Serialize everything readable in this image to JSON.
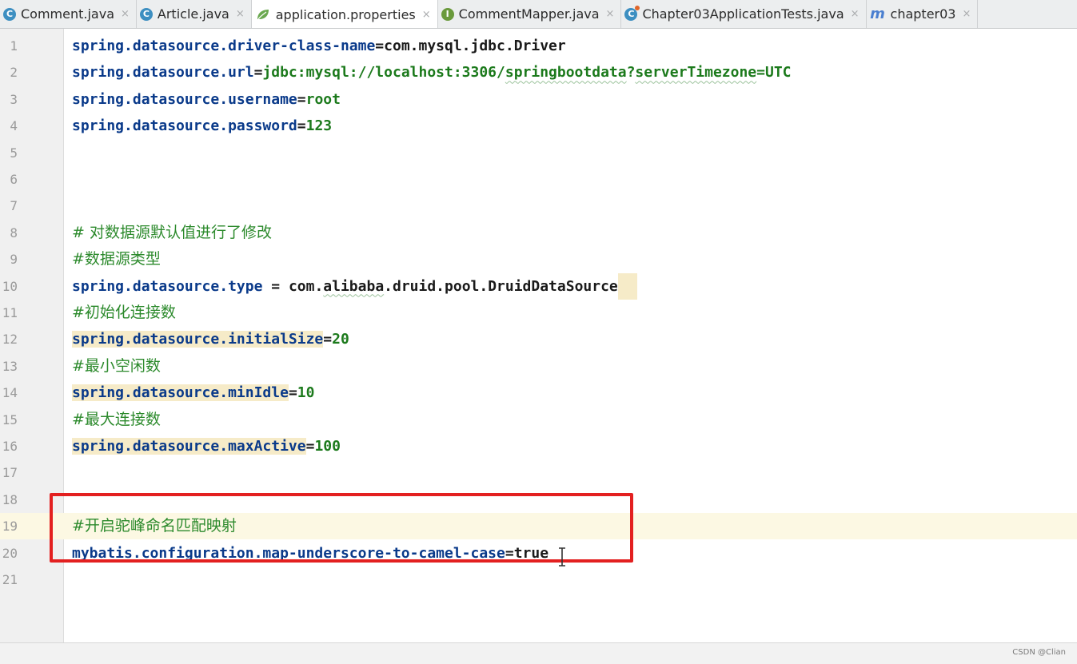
{
  "tabs": [
    {
      "label": "Comment.java",
      "icon": "class-icon",
      "glyph": "C",
      "active": false
    },
    {
      "label": "Article.java",
      "icon": "class-icon",
      "glyph": "C",
      "active": false
    },
    {
      "label": "application.properties",
      "icon": "spring-leaf-icon",
      "glyph": "",
      "active": true
    },
    {
      "label": "CommentMapper.java",
      "icon": "interface-icon",
      "glyph": "I",
      "active": false
    },
    {
      "label": "Chapter03ApplicationTests.java",
      "icon": "test-class-icon",
      "glyph": "C",
      "active": false
    },
    {
      "label": "chapter03",
      "icon": "maven-icon",
      "glyph": "m",
      "active": false
    }
  ],
  "close_glyph": "×",
  "editor": {
    "current_line": 19,
    "lines": [
      {
        "n": "1",
        "parts": [
          {
            "t": "spring.datasource.driver-class-name",
            "c": "key"
          },
          {
            "t": "=",
            "c": "sep"
          },
          {
            "t": "com.mysql.jdbc.Driver",
            "c": "val-plain"
          }
        ]
      },
      {
        "n": "2",
        "parts": [
          {
            "t": "spring.datasource.url",
            "c": "key"
          },
          {
            "t": "=",
            "c": "sep"
          },
          {
            "t": "jdbc:mysql://localhost:3306/",
            "c": "val"
          },
          {
            "t": "springbootdata",
            "c": "val squig"
          },
          {
            "t": "?",
            "c": "val"
          },
          {
            "t": "serverTimezone",
            "c": "val squig"
          },
          {
            "t": "=UTC",
            "c": "val"
          }
        ]
      },
      {
        "n": "3",
        "parts": [
          {
            "t": "spring.datasource.username",
            "c": "key"
          },
          {
            "t": "=",
            "c": "sep"
          },
          {
            "t": "root",
            "c": "val"
          }
        ]
      },
      {
        "n": "4",
        "parts": [
          {
            "t": "spring.datasource.password",
            "c": "key"
          },
          {
            "t": "=",
            "c": "sep"
          },
          {
            "t": "123",
            "c": "val"
          }
        ]
      },
      {
        "n": "5",
        "parts": []
      },
      {
        "n": "6",
        "parts": []
      },
      {
        "n": "7",
        "parts": []
      },
      {
        "n": "8",
        "parts": [
          {
            "t": "# 对数据源默认值进行了修改",
            "c": "cmt"
          }
        ]
      },
      {
        "n": "9",
        "parts": [
          {
            "t": "#数据源类型",
            "c": "cmt"
          }
        ]
      },
      {
        "n": "10",
        "parts": [
          {
            "t": "spring.datasource.type",
            "c": "key"
          },
          {
            "t": " = ",
            "c": "sep"
          },
          {
            "t": "com.",
            "c": "val-plain"
          },
          {
            "t": "alibaba",
            "c": "val-plain squig"
          },
          {
            "t": ".druid.pool.DruidDataSource",
            "c": "val-plain"
          }
        ],
        "trail_hl": true
      },
      {
        "n": "11",
        "parts": [
          {
            "t": "#初始化连接数",
            "c": "cmt"
          }
        ]
      },
      {
        "n": "12",
        "parts": [
          {
            "t": "spring.datasource.initialSize",
            "c": "key hl"
          },
          {
            "t": "=",
            "c": "sep"
          },
          {
            "t": "20",
            "c": "val"
          }
        ]
      },
      {
        "n": "13",
        "parts": [
          {
            "t": "#最小空闲数",
            "c": "cmt"
          }
        ]
      },
      {
        "n": "14",
        "parts": [
          {
            "t": "spring.datasource.minIdle",
            "c": "key hl"
          },
          {
            "t": "=",
            "c": "sep"
          },
          {
            "t": "10",
            "c": "val"
          }
        ]
      },
      {
        "n": "15",
        "parts": [
          {
            "t": "#最大连接数",
            "c": "cmt"
          }
        ]
      },
      {
        "n": "16",
        "parts": [
          {
            "t": "spring.datasource.maxActive",
            "c": "key hl"
          },
          {
            "t": "=",
            "c": "sep"
          },
          {
            "t": "100",
            "c": "val"
          }
        ]
      },
      {
        "n": "17",
        "parts": []
      },
      {
        "n": "18",
        "parts": []
      },
      {
        "n": "19",
        "parts": [
          {
            "t": "#开启驼峰命名匹配映射",
            "c": "cmt"
          }
        ]
      },
      {
        "n": "20",
        "parts": [
          {
            "t": "mybatis.configuration.map-underscore-to-camel-case",
            "c": "key"
          },
          {
            "t": "=",
            "c": "sep"
          },
          {
            "t": "true",
            "c": "val-plain"
          }
        ]
      },
      {
        "n": "21",
        "parts": []
      }
    ]
  },
  "annotation": {
    "highlight_color": "#e32020"
  },
  "colors": {
    "key": "#0a3a8a",
    "value": "#1c7a1c",
    "comment": "#2c8a2c"
  },
  "watermark": "CSDN @Clian"
}
